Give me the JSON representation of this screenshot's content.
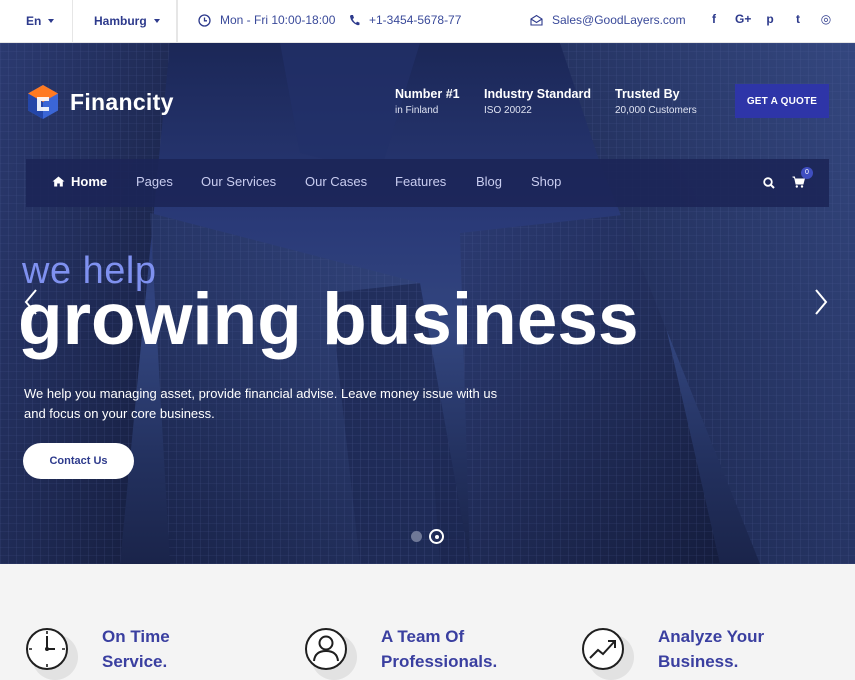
{
  "topbar": {
    "language": "En",
    "city": "Hamburg",
    "hours": "Mon - Fri 10:00-18:00",
    "phone": "+1-3454-5678-77",
    "email": "Sales@GoodLayers.com",
    "social_icons": [
      "facebook-icon",
      "google-plus-icon",
      "pinterest-icon",
      "twitter-icon",
      "instagram-icon"
    ],
    "social_glyphs": [
      "f",
      "G+",
      "p",
      "t",
      "◎"
    ]
  },
  "header": {
    "logo_text": "Financity",
    "badges": [
      {
        "title": "Number #1",
        "sub": "in Finland"
      },
      {
        "title": "Industry Standard",
        "sub": "ISO 20022"
      },
      {
        "title": "Trusted By",
        "sub": "20,000 Customers"
      }
    ],
    "quote_button": "GET A QUOTE"
  },
  "nav": {
    "items": [
      "Home",
      "Pages",
      "Our Services",
      "Our Cases",
      "Features",
      "Blog",
      "Shop"
    ],
    "cart_count": "0"
  },
  "hero": {
    "small_heading": "we help",
    "big_heading": "growing business",
    "text": "We help you managing asset, provide financial advise. Leave money issue with us and focus on your core business.",
    "button": "Contact Us",
    "slides": 2,
    "active_slide": 2
  },
  "features": [
    {
      "line1": "On Time",
      "line2": "Service.",
      "icon": "clock-icon"
    },
    {
      "line1": "A Team Of",
      "line2": "Professionals.",
      "icon": "user-icon"
    },
    {
      "line1": "Analyze Your",
      "line2": "Business.",
      "icon": "growth-chart-icon"
    }
  ],
  "colors": {
    "brand": "#2d3a8c",
    "accent_button": "#2e35a8",
    "heading_light": "#7f91f0",
    "feature_text": "#3a3fa0"
  }
}
